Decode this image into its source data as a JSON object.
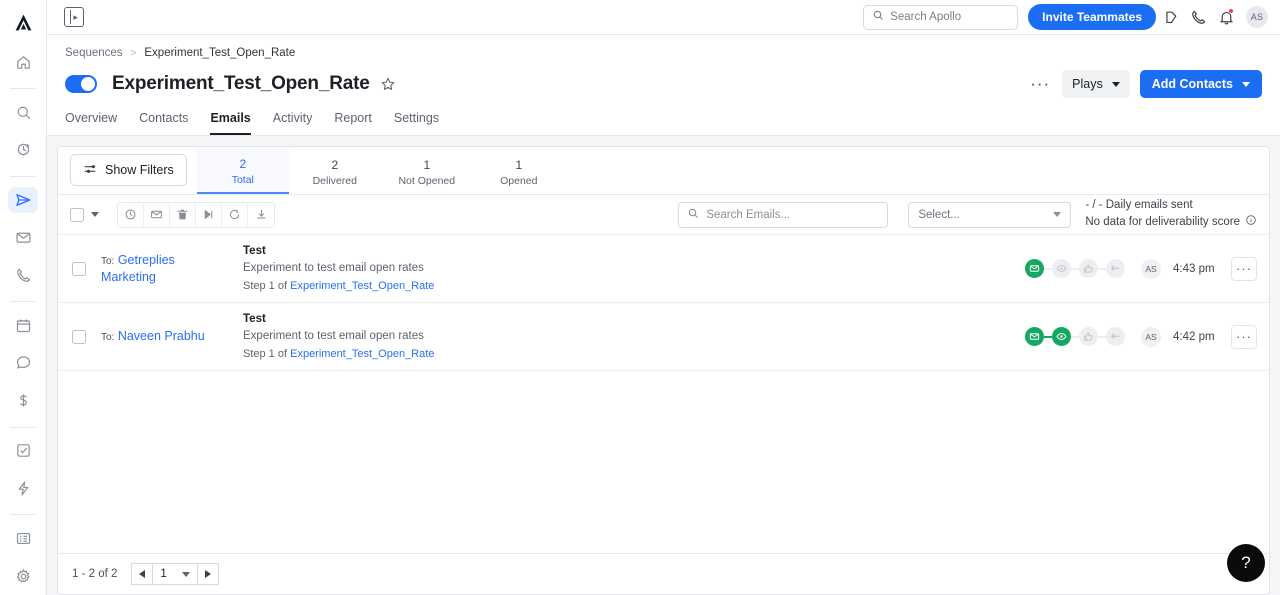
{
  "app": {
    "logo_icon": "apollo-logo-icon",
    "help_label": "?"
  },
  "rail": {
    "items": [
      {
        "name": "home",
        "icon": "home-icon",
        "active": false
      },
      {
        "name": "search",
        "icon": "search-icon",
        "active": false
      },
      {
        "name": "refresh",
        "icon": "sync-icon",
        "active": false
      },
      {
        "name": "sequences",
        "icon": "send-icon",
        "active": true
      },
      {
        "name": "emails",
        "icon": "envelope-icon",
        "active": false
      },
      {
        "name": "calls",
        "icon": "phone-icon",
        "active": false
      },
      {
        "name": "meetings",
        "icon": "calendar-icon",
        "active": false
      },
      {
        "name": "conversations",
        "icon": "chat-bubble-icon",
        "active": false
      },
      {
        "name": "deals",
        "icon": "dollar-icon",
        "active": false
      },
      {
        "name": "tasks",
        "icon": "checkbox-task-icon",
        "active": false
      },
      {
        "name": "workflows",
        "icon": "lightning-icon",
        "active": false
      },
      {
        "name": "lists",
        "icon": "list-icon",
        "active": false
      },
      {
        "name": "settings",
        "icon": "gear-icon",
        "active": false
      }
    ]
  },
  "topbar": {
    "panel_toggle_icon": "panel-expand-icon",
    "search": {
      "placeholder": "Search Apollo",
      "value": "",
      "icon": "search-icon"
    },
    "invite_label": "Invite Teammates",
    "icons": [
      {
        "name": "rewards-icon"
      },
      {
        "name": "phone-icon"
      },
      {
        "name": "bell-icon",
        "badge": true
      }
    ],
    "avatar_initials": "AS"
  },
  "header": {
    "breadcrumb": {
      "root": "Sequences",
      "separator": ">",
      "current": "Experiment_Test_Open_Rate"
    },
    "toggle_on": true,
    "title": "Experiment_Test_Open_Rate",
    "star_icon": "star-outline-icon",
    "more_label": "···",
    "plays_label": "Plays",
    "add_contacts_label": "Add Contacts",
    "tabs": [
      {
        "label": "Overview",
        "active": false
      },
      {
        "label": "Contacts",
        "active": false
      },
      {
        "label": "Emails",
        "active": true
      },
      {
        "label": "Activity",
        "active": false
      },
      {
        "label": "Report",
        "active": false
      },
      {
        "label": "Settings",
        "active": false
      }
    ]
  },
  "filters": {
    "show_filters_label": "Show Filters",
    "show_filters_icon": "filter-sliders-icon",
    "stats": [
      {
        "num": "2",
        "label": "Total",
        "active": true
      },
      {
        "num": "2",
        "label": "Delivered",
        "active": false
      },
      {
        "num": "1",
        "label": "Not Opened",
        "active": false
      },
      {
        "num": "1",
        "label": "Opened",
        "active": false
      }
    ]
  },
  "toolbar": {
    "select_all_checked": false,
    "icons": [
      {
        "name": "schedule-clock-icon"
      },
      {
        "name": "envelope-icon"
      },
      {
        "name": "trash-icon"
      },
      {
        "name": "skip-icon"
      },
      {
        "name": "retry-icon"
      },
      {
        "name": "download-icon"
      }
    ],
    "search": {
      "placeholder": "Search Emails...",
      "value": "",
      "icon": "search-icon"
    },
    "select": {
      "value": "Select...",
      "icon": "chevron-down-icon"
    },
    "daily_emails_sent": "- / - Daily emails sent",
    "deliverability": "No data for deliverability score",
    "info_icon": "info-icon"
  },
  "emails": [
    {
      "to_label": "To:",
      "to_name": "Getreplies Marketing",
      "subject": "Test",
      "preview": "Experiment to test email open rates",
      "step_prefix": "Step 1 of",
      "step_sequence": "Experiment_Test_Open_Rate",
      "status": {
        "delivered": true,
        "opened": false,
        "clicked": false,
        "replied": false
      },
      "avatar_initials": "AS",
      "time": "4:43 pm",
      "more_label": "···"
    },
    {
      "to_label": "To:",
      "to_name": "Naveen Prabhu",
      "subject": "Test",
      "preview": "Experiment to test email open rates",
      "step_prefix": "Step 1 of",
      "step_sequence": "Experiment_Test_Open_Rate",
      "status": {
        "delivered": true,
        "opened": true,
        "clicked": false,
        "replied": false
      },
      "avatar_initials": "AS",
      "time": "4:42 pm",
      "more_label": "···"
    }
  ],
  "pager": {
    "count_text": "1 - 2 of 2",
    "prev_icon": "chevron-left-icon",
    "page_value": "1",
    "next_icon": "chevron-right-icon"
  },
  "colors": {
    "accent_blue": "#1b6ef3",
    "link_blue": "#2b6ef6",
    "success_green": "#15a862",
    "badge_red": "#ef4444",
    "text_dark": "#1d2026"
  }
}
